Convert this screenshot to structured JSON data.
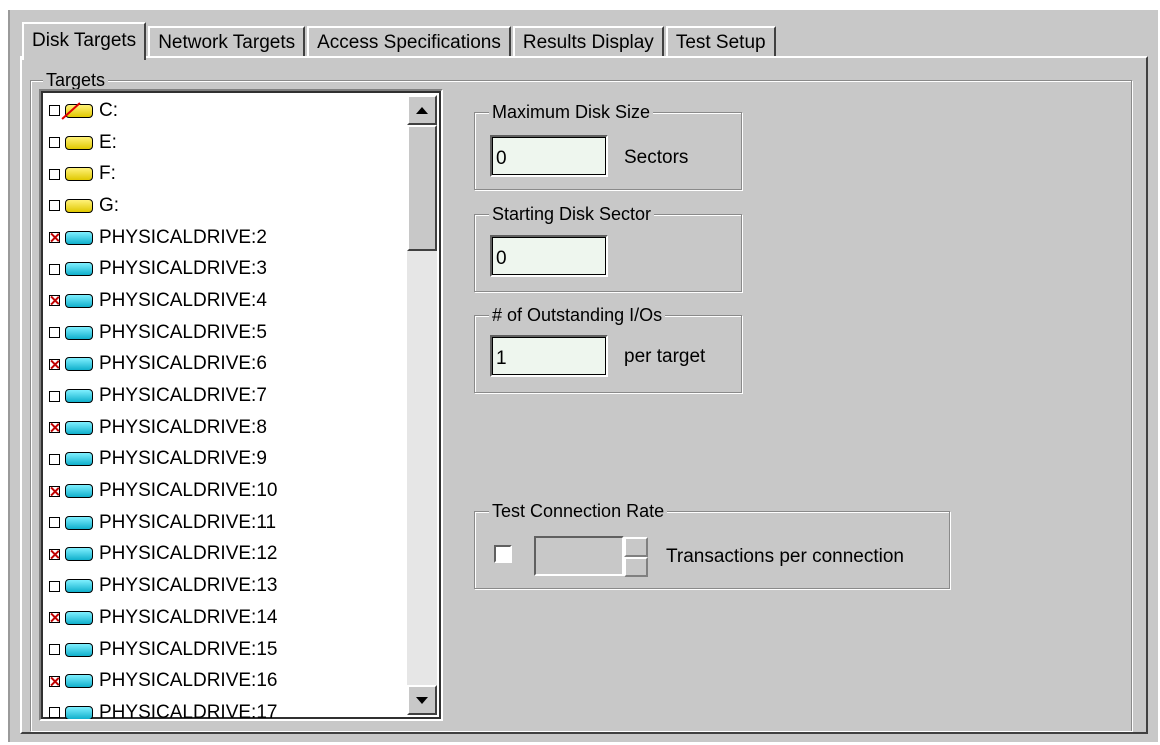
{
  "tabs": [
    {
      "label": "Disk Targets",
      "active": true
    },
    {
      "label": "Network Targets",
      "active": false
    },
    {
      "label": "Access Specifications",
      "active": false
    },
    {
      "label": "Results Display",
      "active": false
    },
    {
      "label": "Test Setup",
      "active": false
    }
  ],
  "targets": {
    "title": "Targets",
    "items": [
      {
        "label": "C:",
        "checked": false,
        "type": "logical",
        "icon": "drive-unavailable-icon"
      },
      {
        "label": "E:",
        "checked": false,
        "type": "logical",
        "icon": "logical-drive-icon"
      },
      {
        "label": "F:",
        "checked": false,
        "type": "logical",
        "icon": "logical-drive-icon"
      },
      {
        "label": "G:",
        "checked": false,
        "type": "logical",
        "icon": "logical-drive-icon"
      },
      {
        "label": "PHYSICALDRIVE:2",
        "checked": true,
        "type": "physical",
        "icon": "physical-drive-icon"
      },
      {
        "label": "PHYSICALDRIVE:3",
        "checked": false,
        "type": "physical",
        "icon": "physical-drive-icon"
      },
      {
        "label": "PHYSICALDRIVE:4",
        "checked": true,
        "type": "physical",
        "icon": "physical-drive-icon"
      },
      {
        "label": "PHYSICALDRIVE:5",
        "checked": false,
        "type": "physical",
        "icon": "physical-drive-icon"
      },
      {
        "label": "PHYSICALDRIVE:6",
        "checked": true,
        "type": "physical",
        "icon": "physical-drive-icon"
      },
      {
        "label": "PHYSICALDRIVE:7",
        "checked": false,
        "type": "physical",
        "icon": "physical-drive-icon"
      },
      {
        "label": "PHYSICALDRIVE:8",
        "checked": true,
        "type": "physical",
        "icon": "physical-drive-icon"
      },
      {
        "label": "PHYSICALDRIVE:9",
        "checked": false,
        "type": "physical",
        "icon": "physical-drive-icon"
      },
      {
        "label": "PHYSICALDRIVE:10",
        "checked": true,
        "type": "physical",
        "icon": "physical-drive-icon"
      },
      {
        "label": "PHYSICALDRIVE:11",
        "checked": false,
        "type": "physical",
        "icon": "physical-drive-icon"
      },
      {
        "label": "PHYSICALDRIVE:12",
        "checked": true,
        "type": "physical",
        "icon": "physical-drive-icon"
      },
      {
        "label": "PHYSICALDRIVE:13",
        "checked": false,
        "type": "physical",
        "icon": "physical-drive-icon"
      },
      {
        "label": "PHYSICALDRIVE:14",
        "checked": true,
        "type": "physical",
        "icon": "physical-drive-icon"
      },
      {
        "label": "PHYSICALDRIVE:15",
        "checked": false,
        "type": "physical",
        "icon": "physical-drive-icon"
      },
      {
        "label": "PHYSICALDRIVE:16",
        "checked": true,
        "type": "physical",
        "icon": "physical-drive-icon"
      },
      {
        "label": "PHYSICALDRIVE:17",
        "checked": false,
        "type": "physical",
        "icon": "physical-drive-icon"
      }
    ]
  },
  "max_disk_size": {
    "title": "Maximum Disk Size",
    "value": "0",
    "unit": "Sectors"
  },
  "starting_disk_sector": {
    "title": "Starting Disk Sector",
    "value": "0"
  },
  "outstanding_ios": {
    "title": "# of Outstanding I/Os",
    "value": "1",
    "unit": "per target"
  },
  "test_connection_rate": {
    "title": "Test Connection Rate",
    "checked": false,
    "value": "",
    "unit": "Transactions per connection"
  }
}
